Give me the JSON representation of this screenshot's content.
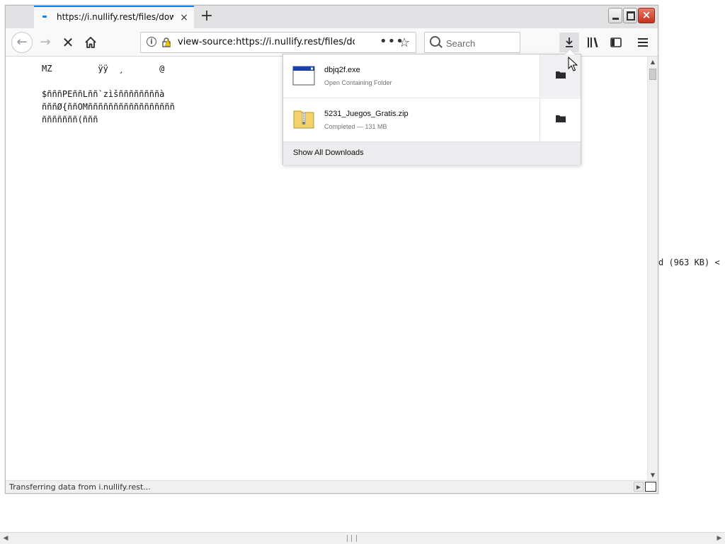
{
  "tab": {
    "title": "https://i.nullify.rest/files/download",
    "close": "×",
    "new": "+"
  },
  "window": {
    "close": "×"
  },
  "nav": {
    "url": "view-source:https://i.nullify.rest/files/download",
    "search_placeholder": "Search",
    "page_actions": "•••",
    "bookmark_star": "☆"
  },
  "page": {
    "source_lines": [
      "MZ \u0003  \u0004  ÿÿ  ¸       @                                       ",
      "",
      "$ñññPEññLññ`zìšññññññññà",
      "ñññØ{ññOMñññññññññññññññññ",
      "ñññññññ(ñññ"
    ],
    "background_text": "d (963 KB) <"
  },
  "status": {
    "text": "Transferring data from i.nullify.rest..."
  },
  "downloads": {
    "items": [
      {
        "name": "dbjq2f.exe",
        "sub": "Open Containing Folder"
      },
      {
        "name": "5231_Juegos_Gratis.zip",
        "sub": "Completed — 131 MB"
      }
    ],
    "footer": "Show All Downloads"
  }
}
